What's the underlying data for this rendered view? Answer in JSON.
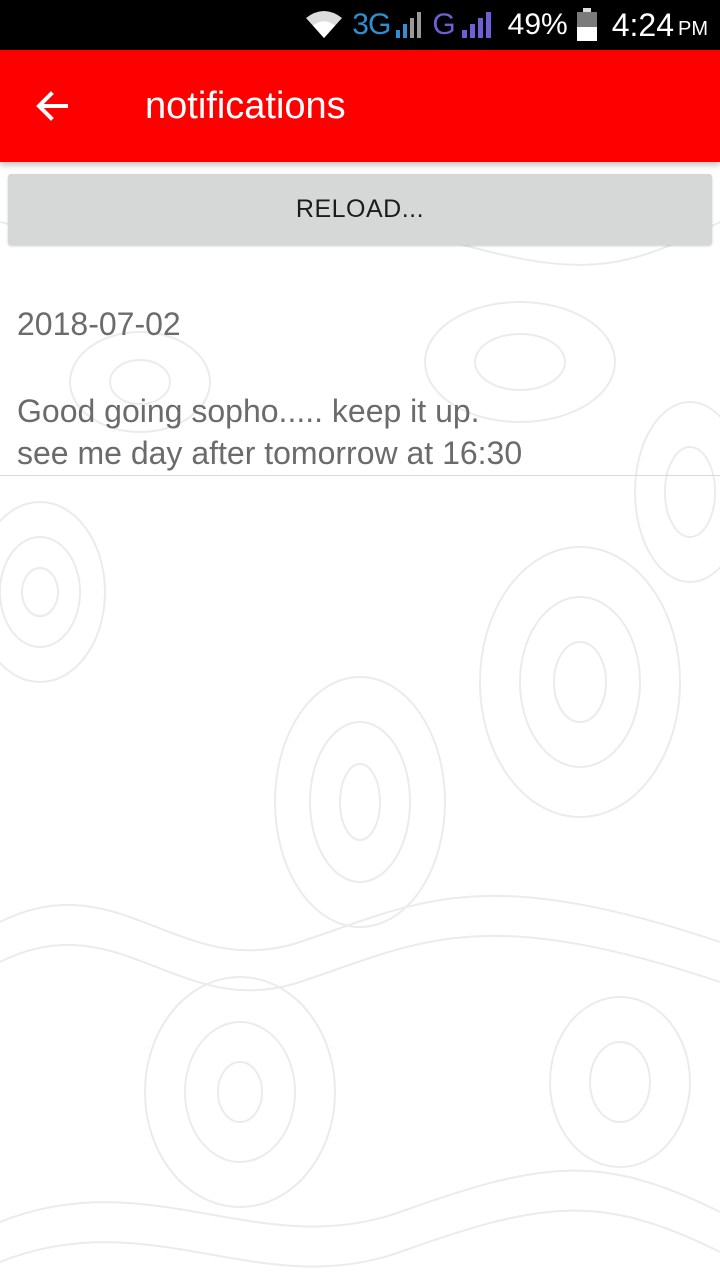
{
  "status_bar": {
    "network_3g": "3G",
    "network_g": "G",
    "battery_percent": "49%",
    "time": "4:24",
    "am_pm": "PM",
    "icons": [
      "wifi-icon",
      "signal-icon",
      "signal-icon",
      "battery-icon"
    ]
  },
  "toolbar": {
    "title": "notifications",
    "back_icon": "arrow-left-icon",
    "color": "#ff0000"
  },
  "reload_button": {
    "label": "RELOAD..."
  },
  "notifications": [
    {
      "date": "2018-07-02",
      "message": "Good going sopho..... keep it up.\nsee me day after tomorrow at 16:30"
    }
  ]
}
